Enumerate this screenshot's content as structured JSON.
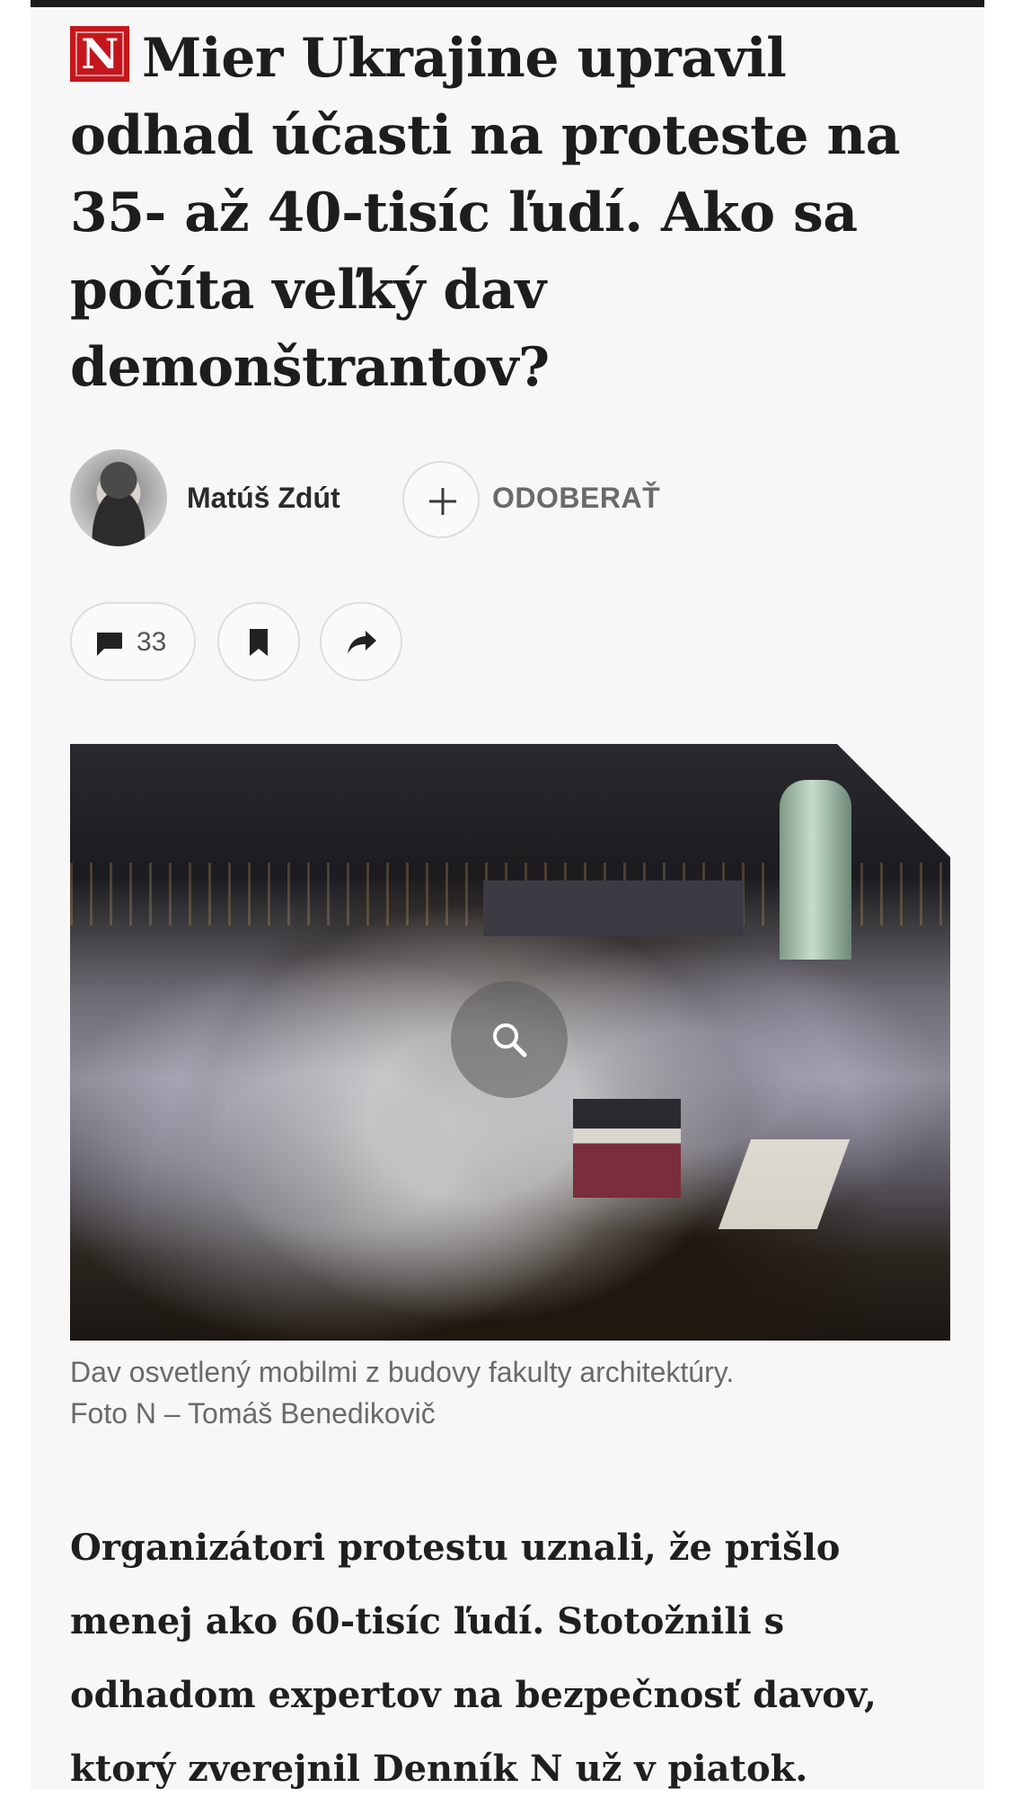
{
  "article": {
    "brand_logo": "N",
    "headline": "Mier Ukrajine upravil odhad účasti na proteste na 35- až 40-tisíc ľudí. Ako sa počíta veľký dav demonštrantov?",
    "author": {
      "name": "Matúš Zdút",
      "follow_label": "ODOBERAŤ",
      "avatar_icon": "author-photo"
    },
    "actions": {
      "comments_count": "33",
      "comments_icon": "comment-icon",
      "bookmark_icon": "bookmark-icon",
      "share_icon": "share-icon"
    },
    "image": {
      "zoom_icon": "search-icon",
      "caption_line1": "Dav osvetlený mobilmi z budovy fakulty architektúry.",
      "caption_line2": "Foto N – Tomáš Benedikovič"
    },
    "lead": "Organizátori protestu uznali, že prišlo menej ako 60-tisíc ľudí. Stotožnili s odhadom expertov na bezpečnosť davov, ktorý zverejnil Denník N už v piatok."
  },
  "colors": {
    "brand": "#c4171d",
    "text": "#1d1d1d",
    "muted": "#6a6a6a",
    "background": "#f7f7f7"
  }
}
